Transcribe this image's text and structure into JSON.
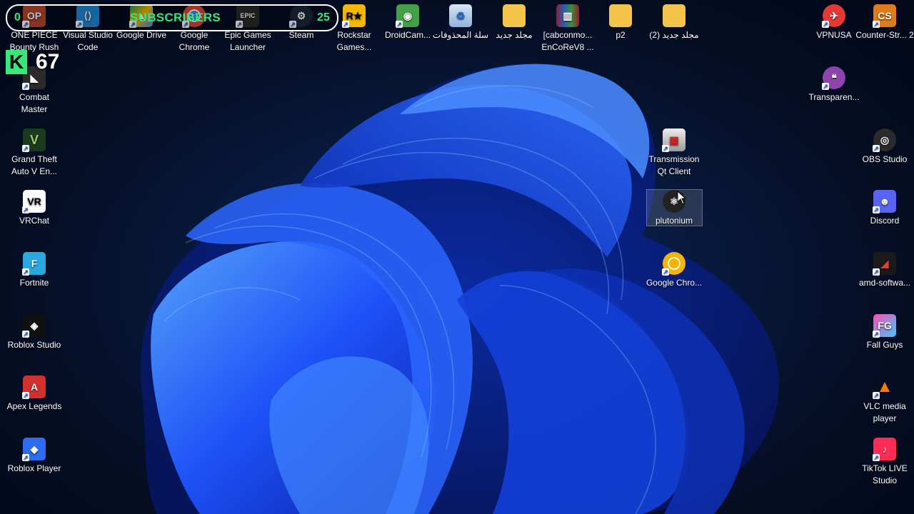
{
  "overlay": {
    "left_count": "0",
    "label": "SUBSCRIBERS",
    "right_count": "25"
  },
  "kick": {
    "logo": "K",
    "count": "67"
  },
  "icons": {
    "onepiece": "ONE PIECE Bounty Rush",
    "vscode": "Visual Studio Code",
    "gdrive": "Google Drive",
    "chrome": "Google Chrome",
    "epic": "Epic Games Launcher",
    "steam": "Steam",
    "rockstar": "Rockstar Games...",
    "droidcam": "DroidCam...",
    "recycle": "سلة المحذوفات",
    "folder1": "مجلد جديد",
    "cabcon": "[cabconmo... EnCoReV8 ...",
    "p2": "p2",
    "folder2": "مجلد جديد (2)",
    "vpnusa": "VPNUSA",
    "counterstrike": "Counter-Str... 2",
    "combat": "Combat Master",
    "transparent": "Transparen...",
    "gta": "Grand Theft Auto V En...",
    "transmission": "Transmission Qt Client",
    "obs": "OBS Studio",
    "vrchat": "VRChat",
    "plutonium": "plutonium",
    "discord": "Discord",
    "fortnite": "Fortnite",
    "chrome2": "Google Chro...",
    "amd": "amd-softwa...",
    "robloxstudio": "Roblox Studio",
    "fallguys": "Fall Guys",
    "apex": "Apex Legends",
    "vlc": "VLC media player",
    "robloxplayer": "Roblox Player",
    "tiktok": "TikTok LIVE Studio"
  },
  "colors": {
    "accent": "#39e67a",
    "wallpaper_blue": "#1e5bff"
  }
}
